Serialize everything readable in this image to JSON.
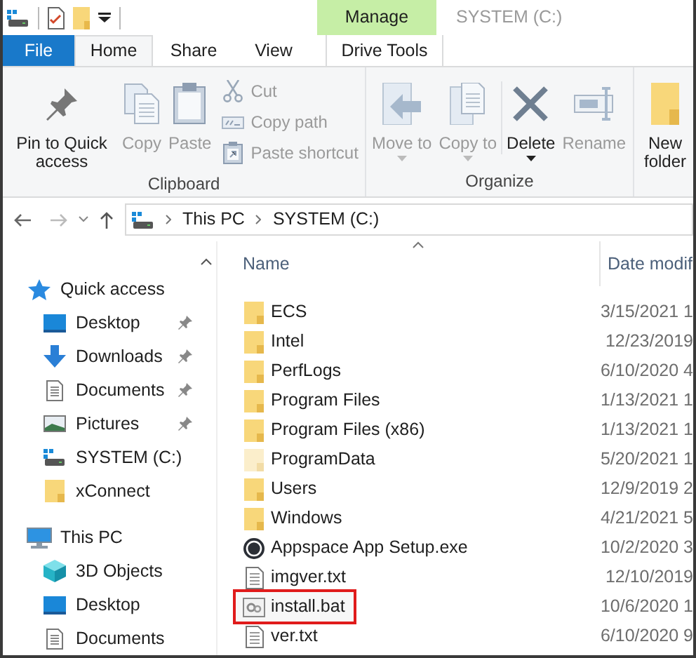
{
  "window": {
    "title": "SYSTEM (C:)",
    "context_tab": "Manage"
  },
  "tabs": [
    {
      "label": "File",
      "kind": "file",
      "selected": false
    },
    {
      "label": "Home",
      "kind": "tab",
      "selected": true
    },
    {
      "label": "Share",
      "kind": "tab",
      "selected": false
    },
    {
      "label": "View",
      "kind": "tab",
      "selected": false
    },
    {
      "label": "Drive Tools",
      "kind": "context",
      "selected": false
    }
  ],
  "ribbon": {
    "groups": [
      {
        "label": "Clipboard",
        "items": [
          {
            "kind": "pin",
            "label": "Pin to Quick access",
            "disabled": false
          },
          {
            "kind": "copy",
            "label": "Copy",
            "disabled": true
          },
          {
            "kind": "paste",
            "label": "Paste",
            "disabled": true
          },
          {
            "kind": "stack",
            "items": [
              {
                "kind": "cut",
                "label": "Cut",
                "disabled": true
              },
              {
                "kind": "copypath",
                "label": "Copy path",
                "disabled": true
              },
              {
                "kind": "shortcut",
                "label": "Paste shortcut",
                "disabled": true
              }
            ]
          }
        ]
      },
      {
        "label": "Organize",
        "items": [
          {
            "kind": "move",
            "label": "Move to",
            "dropdown": true,
            "disabled": true
          },
          {
            "kind": "copyto",
            "label": "Copy to",
            "dropdown": true,
            "disabled": true
          },
          {
            "kind": "delete",
            "label": "Delete",
            "dropdown": true,
            "disabled": false
          },
          {
            "kind": "rename",
            "label": "Rename",
            "dropdown": false,
            "disabled": true
          }
        ]
      },
      {
        "items": [
          {
            "kind": "newfolder",
            "label": "New folder",
            "disabled": false
          }
        ]
      }
    ]
  },
  "address": {
    "path": [
      "This PC",
      "SYSTEM (C:)"
    ]
  },
  "sidebar": {
    "items": [
      {
        "label": "Quick access",
        "kind": "star",
        "children": [
          {
            "label": "Desktop",
            "kind": "desktop",
            "pinned": true
          },
          {
            "label": "Downloads",
            "kind": "downloads",
            "pinned": true
          },
          {
            "label": "Documents",
            "kind": "documents",
            "pinned": true
          },
          {
            "label": "Pictures",
            "kind": "pictures",
            "pinned": true
          },
          {
            "label": "SYSTEM (C:)",
            "kind": "drive",
            "pinned": false
          },
          {
            "label": "xConnect",
            "kind": "folder",
            "pinned": false
          }
        ]
      },
      {
        "label": "This PC",
        "kind": "pc",
        "children": [
          {
            "label": "3D Objects",
            "kind": "cube"
          },
          {
            "label": "Desktop",
            "kind": "desktop"
          },
          {
            "label": "Documents",
            "kind": "documents"
          }
        ]
      }
    ]
  },
  "table": {
    "columns": [
      "Name",
      "Date modif"
    ],
    "rows": [
      {
        "kind": "folder",
        "name": "ECS",
        "date": "3/15/2021 1",
        "highlighted": false
      },
      {
        "kind": "folder",
        "name": "Intel",
        "date": "12/23/2019",
        "highlighted": false
      },
      {
        "kind": "folder",
        "name": "PerfLogs",
        "date": "6/10/2020 4",
        "highlighted": false
      },
      {
        "kind": "folder",
        "name": "Program Files",
        "date": "1/13/2021 1",
        "highlighted": false
      },
      {
        "kind": "folder",
        "name": "Program Files (x86)",
        "date": "1/13/2021 1",
        "highlighted": false
      },
      {
        "kind": "hidden-folder",
        "name": "ProgramData",
        "date": "5/20/2021 1",
        "highlighted": false
      },
      {
        "kind": "folder",
        "name": "Users",
        "date": "12/9/2019 2",
        "highlighted": false
      },
      {
        "kind": "folder",
        "name": "Windows",
        "date": "4/21/2021 5",
        "highlighted": false
      },
      {
        "kind": "exe",
        "name": "Appspace App Setup.exe",
        "date": "10/2/2020 3",
        "highlighted": false
      },
      {
        "kind": "txt",
        "name": "imgver.txt",
        "date": "12/10/2019",
        "highlighted": false
      },
      {
        "kind": "bat",
        "name": "install.bat",
        "date": "10/6/2020 1",
        "highlighted": true
      },
      {
        "kind": "txt",
        "name": "ver.txt",
        "date": "6/10/2020 9",
        "highlighted": false
      }
    ]
  }
}
